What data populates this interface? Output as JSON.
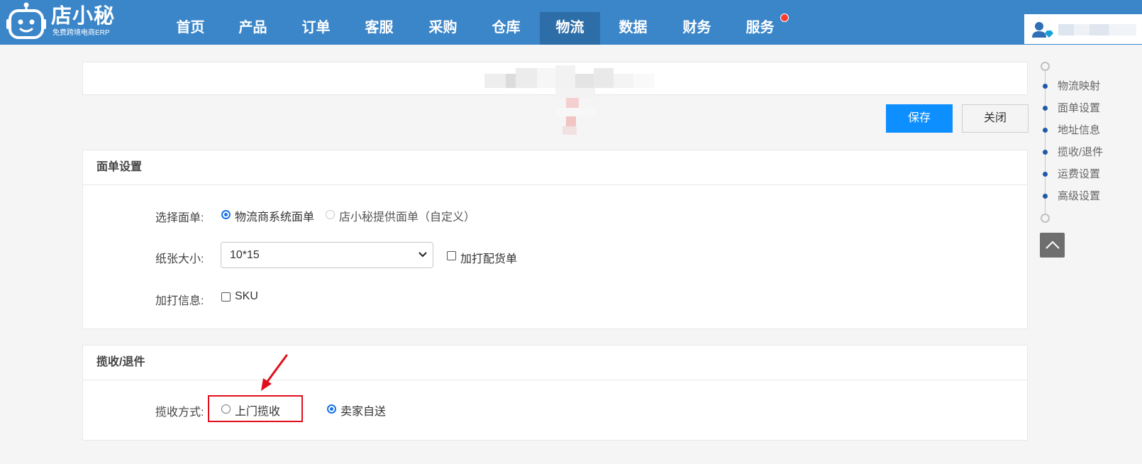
{
  "header": {
    "brand": "店小秘",
    "tagline": "免费跨境电商ERP",
    "nav": [
      {
        "label": "首页"
      },
      {
        "label": "产品"
      },
      {
        "label": "订单"
      },
      {
        "label": "客服"
      },
      {
        "label": "采购"
      },
      {
        "label": "仓库"
      },
      {
        "label": "物流"
      },
      {
        "label": "数据"
      },
      {
        "label": "财务"
      },
      {
        "label": "服务"
      }
    ],
    "active_nav": "物流",
    "accent_color": "#3b86c9"
  },
  "actions": {
    "save_label": "保存",
    "close_label": "关闭"
  },
  "waybill": {
    "title": "面单设置",
    "select_label": "选择面单:",
    "option_logistics": "物流商系统面单",
    "option_custom": "店小秘提供面单（自定义）",
    "selected_option": "物流商系统面单",
    "paper_label": "纸张大小:",
    "paper_value": "10*15",
    "extra_pick_list": "加打配货单",
    "extra_info_label": "加打信息:",
    "extra_info_sku": "SKU"
  },
  "pickup": {
    "title": "揽收/退件",
    "method_label": "揽收方式:",
    "option_door": "上门揽收",
    "option_self": "卖家自送",
    "selected_option": "卖家自送"
  },
  "anchor_nav": {
    "items": [
      {
        "label": "物流映射"
      },
      {
        "label": "面单设置"
      },
      {
        "label": "地址信息"
      },
      {
        "label": "揽收/退件"
      },
      {
        "label": "运费设置"
      },
      {
        "label": "高级设置"
      }
    ]
  }
}
